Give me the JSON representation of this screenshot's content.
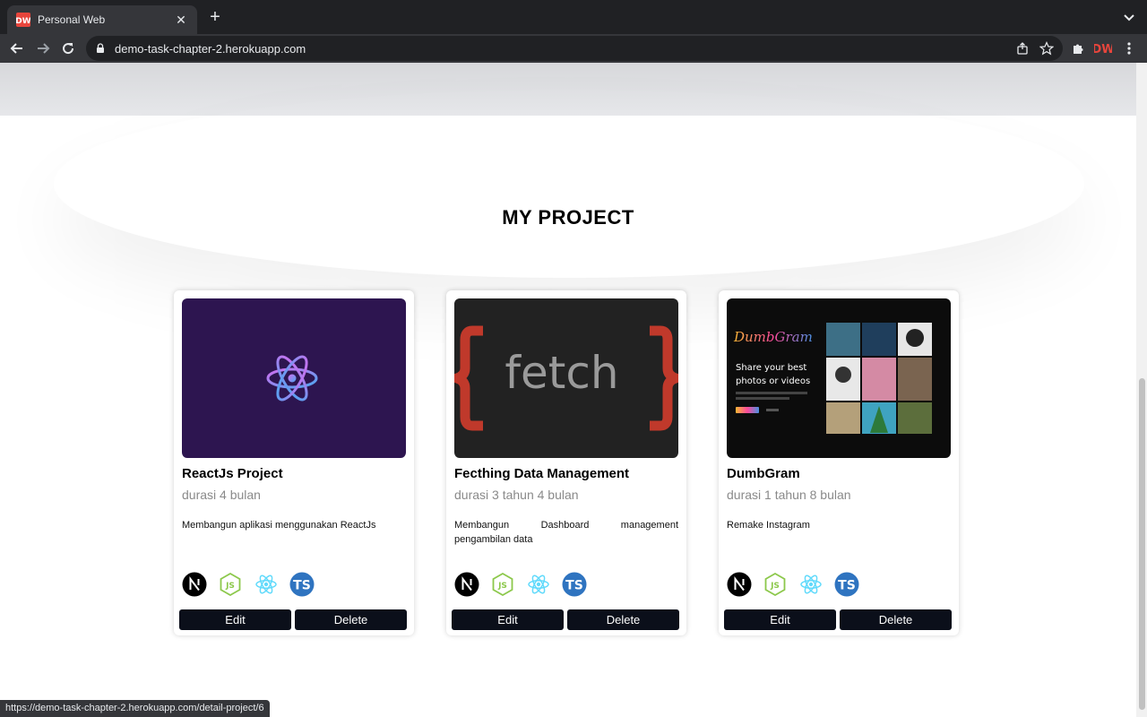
{
  "browser": {
    "tab_title": "Personal Web",
    "url": "demo-task-chapter-2.herokuapp.com",
    "status_url": "https://demo-task-chapter-2.herokuapp.com/detail-project/6"
  },
  "page": {
    "section_title": "MY PROJECT"
  },
  "projects": [
    {
      "title": "ReactJs Project",
      "duration": "durasi 4 bulan",
      "description": "Membangun aplikasi menggunakan ReactJs",
      "image": "react-logo",
      "technologies": [
        "nextjs-icon",
        "nodejs-icon",
        "react-icon",
        "typescript-icon"
      ],
      "edit_label": "Edit",
      "delete_label": "Delete"
    },
    {
      "title": "Fecthing Data Management",
      "duration": "durasi 3 tahun 4 bulan",
      "description": "Membangun Dashboard management pengambilan data",
      "image": "fetch-logo",
      "image_text": "fetch",
      "technologies": [
        "nextjs-icon",
        "nodejs-icon",
        "react-icon",
        "typescript-icon"
      ],
      "edit_label": "Edit",
      "delete_label": "Delete"
    },
    {
      "title": "DumbGram",
      "duration": "durasi 1 tahun 8 bulan",
      "description": "Remake Instagram",
      "image": "dumbgram-screenshot",
      "image_brand": "DumbGram",
      "image_headline": "Share your best photos or videos",
      "technologies": [
        "nextjs-icon",
        "nodejs-icon",
        "react-icon",
        "typescript-icon"
      ],
      "edit_label": "Edit",
      "delete_label": "Delete"
    }
  ],
  "colors": {
    "button_bg": "#0b0f1a",
    "react_bg": "#2d1550",
    "fetch_bg": "#222222",
    "fetch_brace": "#c0392b",
    "ts_blue": "#2f74c0",
    "node_green": "#8cc84b",
    "react_cyan": "#61dafb"
  }
}
